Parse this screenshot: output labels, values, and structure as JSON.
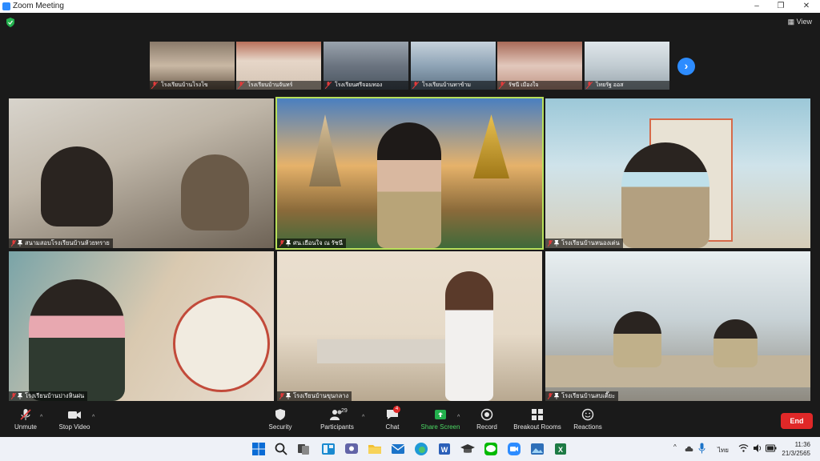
{
  "window": {
    "title": "Zoom Meeting",
    "view_label": "View"
  },
  "colors": {
    "accent": "#2D8CFF",
    "speaking_border": "#b8e05a",
    "end_red": "#e02828",
    "mic_off_red": "#e23b3b"
  },
  "filmstrip": [
    {
      "name": "โรงเรียนบ้านโรงโข"
    },
    {
      "name": "โรงเรียนบ้านจันทร์"
    },
    {
      "name": "โรงเรียนศรีจอมทอง"
    },
    {
      "name": "โรงเรียนบ้านทาข้าม"
    },
    {
      "name": "รัชนี เมืองใจ"
    },
    {
      "name": "ไทยรัฐ ออส"
    }
  ],
  "tiles": [
    {
      "name": "สนามสอบโรงเรียนบ้านห้วยทราย"
    },
    {
      "name": "ศน.เยือนใจ ณ รัชนี",
      "speaking": true
    },
    {
      "name": "โรงเรียนบ้านหนองเต่น"
    },
    {
      "name": "โรงเรียนบ้านปางหินฝน"
    },
    {
      "name": "โรงเรียนบ้านขุนกลาง"
    },
    {
      "name": "โรงเรียนบ้านสบเตี๊ยะ"
    }
  ],
  "toolbar": {
    "unmute": "Unmute",
    "stop_video": "Stop Video",
    "security": "Security",
    "participants": "Participants",
    "participants_count": "29",
    "chat": "Chat",
    "chat_badge": "4",
    "share_screen": "Share Screen",
    "record": "Record",
    "breakout_rooms": "Breakout Rooms",
    "reactions": "Reactions",
    "end": "End"
  },
  "taskbar": {
    "lang": "ไทย",
    "time": "11:36",
    "date": "21/3/2565"
  }
}
